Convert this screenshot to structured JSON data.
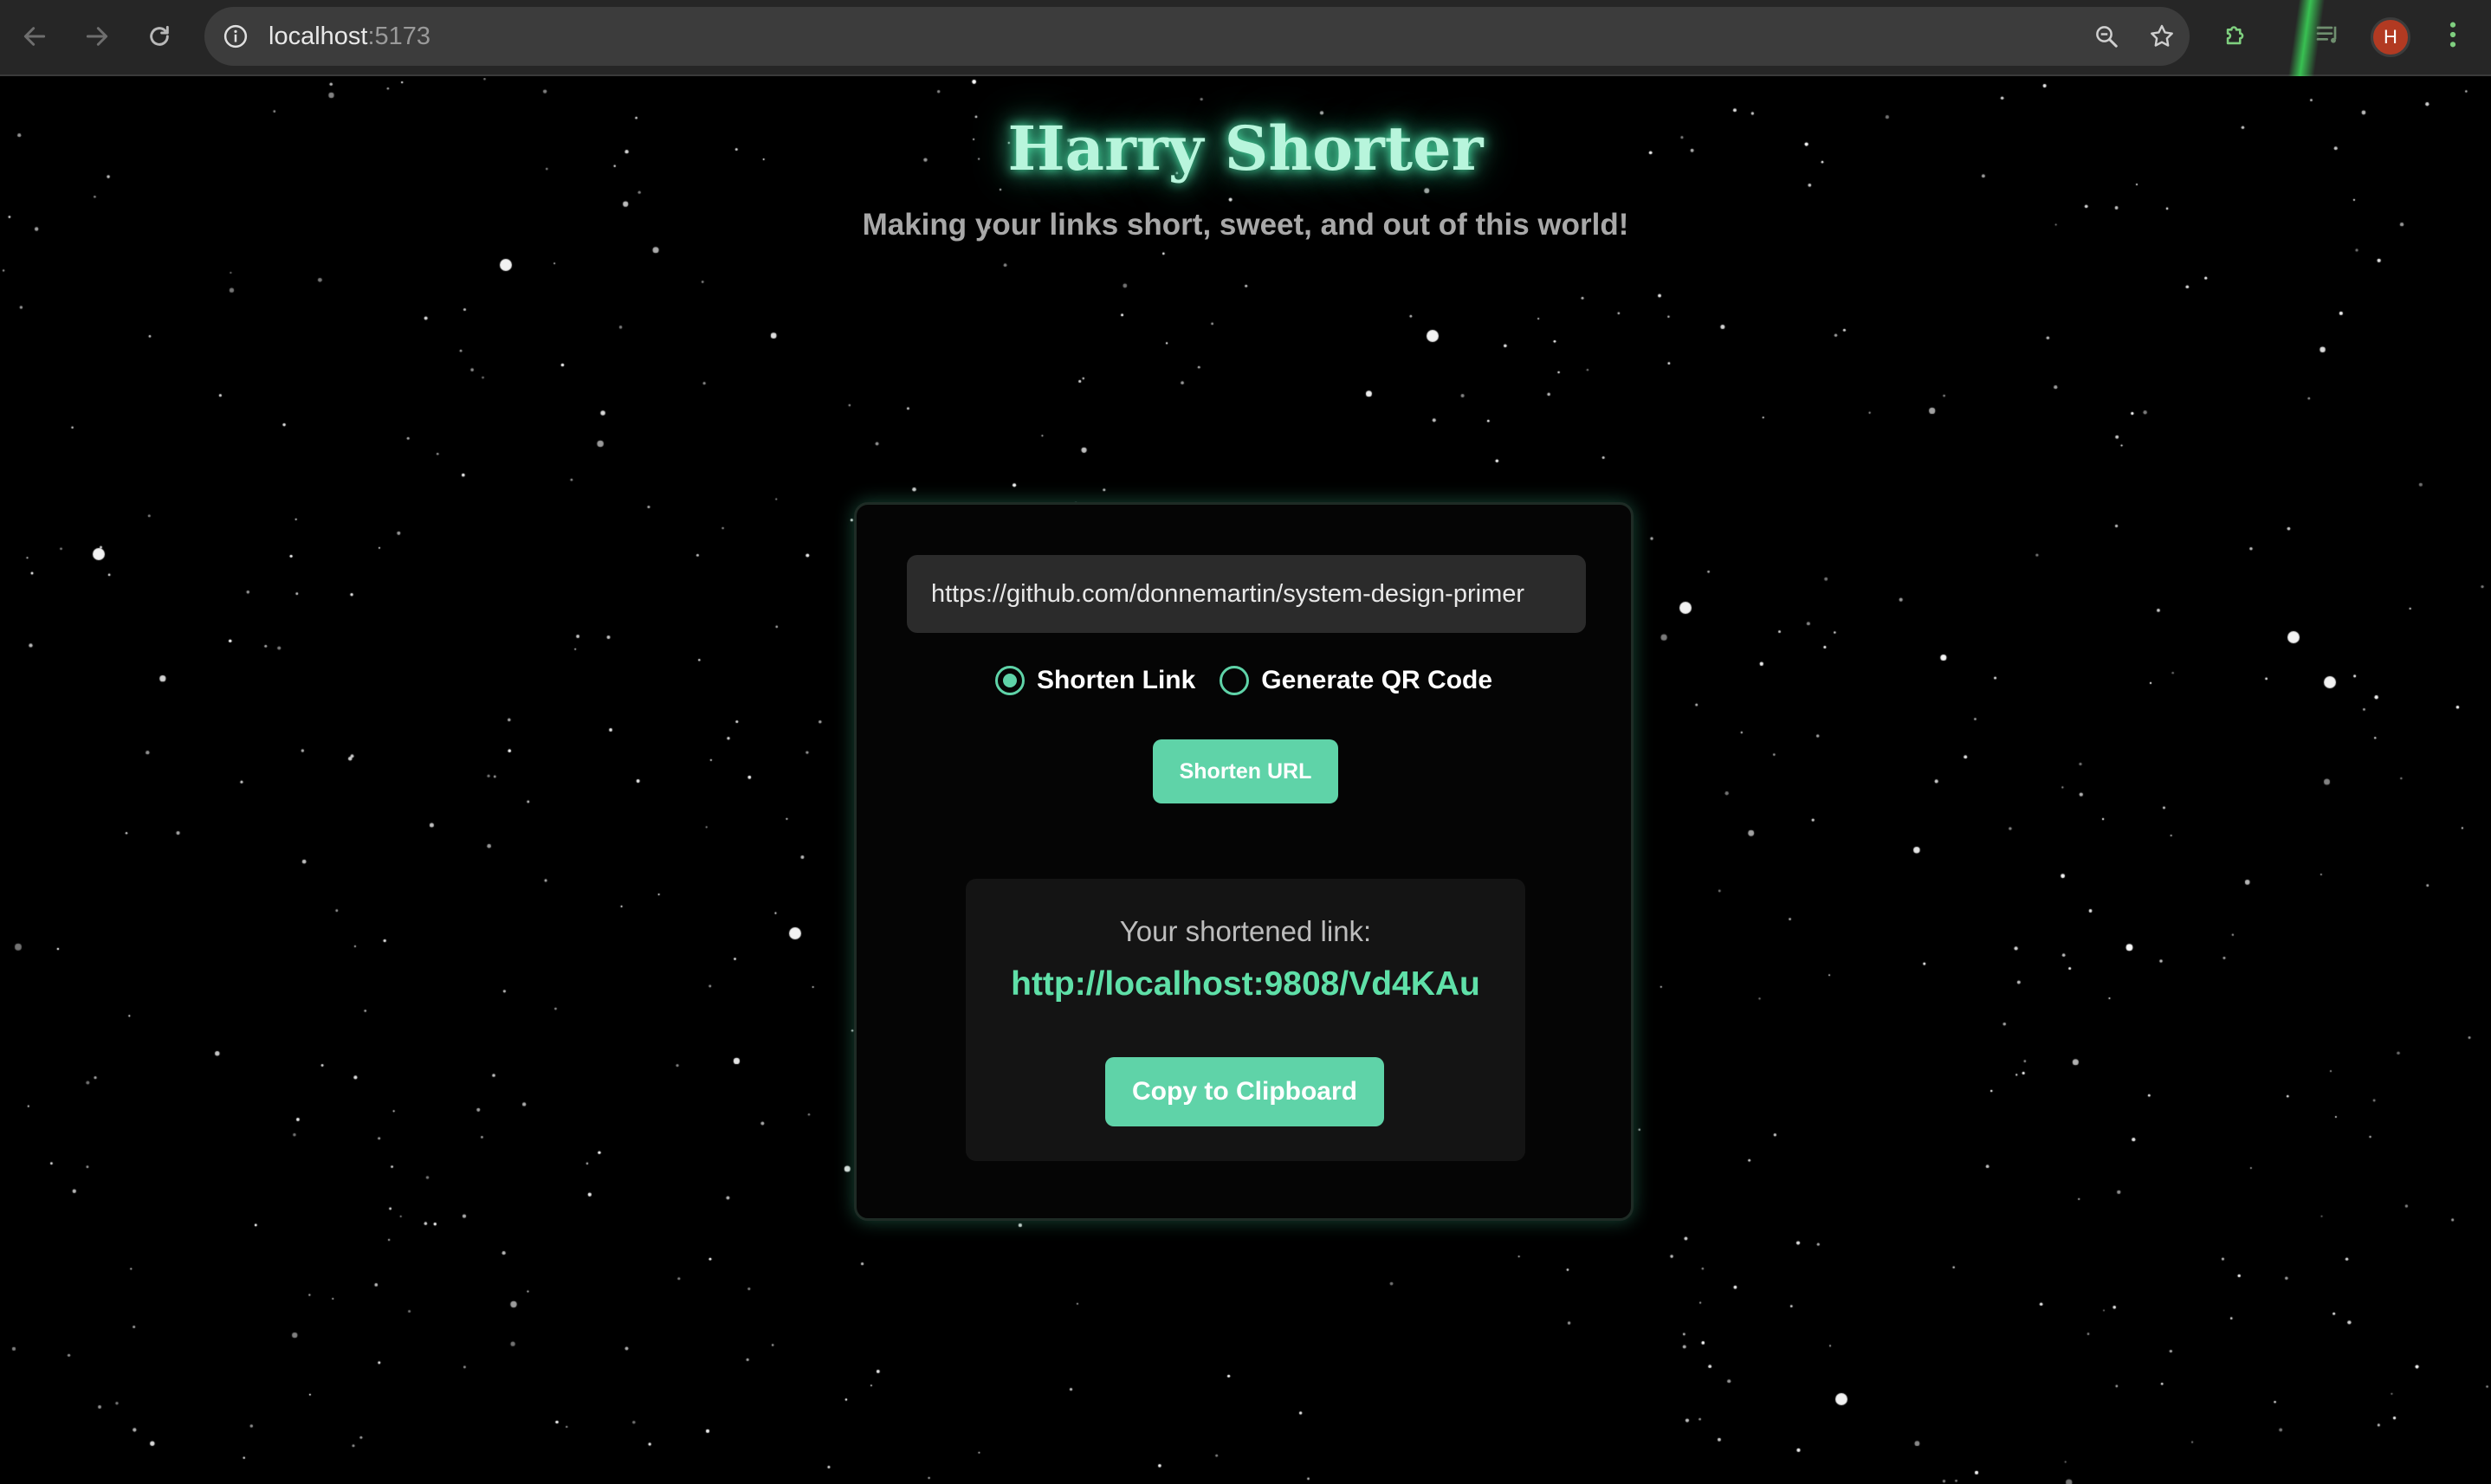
{
  "browser": {
    "url_host": "localhost",
    "url_port": ":5173",
    "profile_initial": "H",
    "icons": {
      "back": "back-arrow-icon",
      "forward": "forward-arrow-icon",
      "reload": "reload-icon",
      "site_info": "info-icon",
      "zoom": "zoom-icon",
      "bookmark": "star-icon",
      "extensions": "puzzle-icon",
      "media": "media-queue-icon",
      "menu": "kebab-menu-icon"
    }
  },
  "page": {
    "title": "Harry Shorter",
    "subtitle": "Making your links short, sweet, and out of this world!",
    "colors": {
      "accent": "#5fd3a8",
      "title_glow": "#4fe0a8",
      "background": "#000000"
    }
  },
  "form": {
    "url_value": "https://github.com/donnemartin/system-design-primer",
    "options": [
      {
        "label": "Shorten Link",
        "checked": true
      },
      {
        "label": "Generate QR Code",
        "checked": false
      }
    ],
    "submit_label": "Shorten URL"
  },
  "result": {
    "label": "Your shortened link:",
    "short_url": "http://localhost:9808/Vd4KAu",
    "copy_label": "Copy to Clipboard"
  }
}
